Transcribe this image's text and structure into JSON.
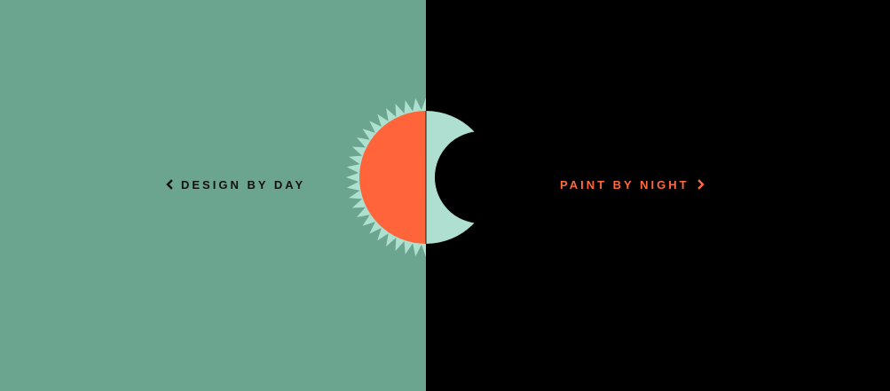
{
  "day": {
    "label": "DESIGN BY DAY",
    "icon": "chevron-left-icon",
    "background": "#6ba58f",
    "text_color": "#111111"
  },
  "night": {
    "label": "PAINT BY NIGHT",
    "icon": "chevron-right-icon",
    "background": "#000000",
    "text_color": "#ff6a3d"
  },
  "emblem": {
    "sun_icon": "sun-icon",
    "moon_icon": "crescent-moon-icon",
    "sun_color": "#ff643a",
    "ray_color": "#aee0d0",
    "moon_color": "#aedfd1"
  }
}
